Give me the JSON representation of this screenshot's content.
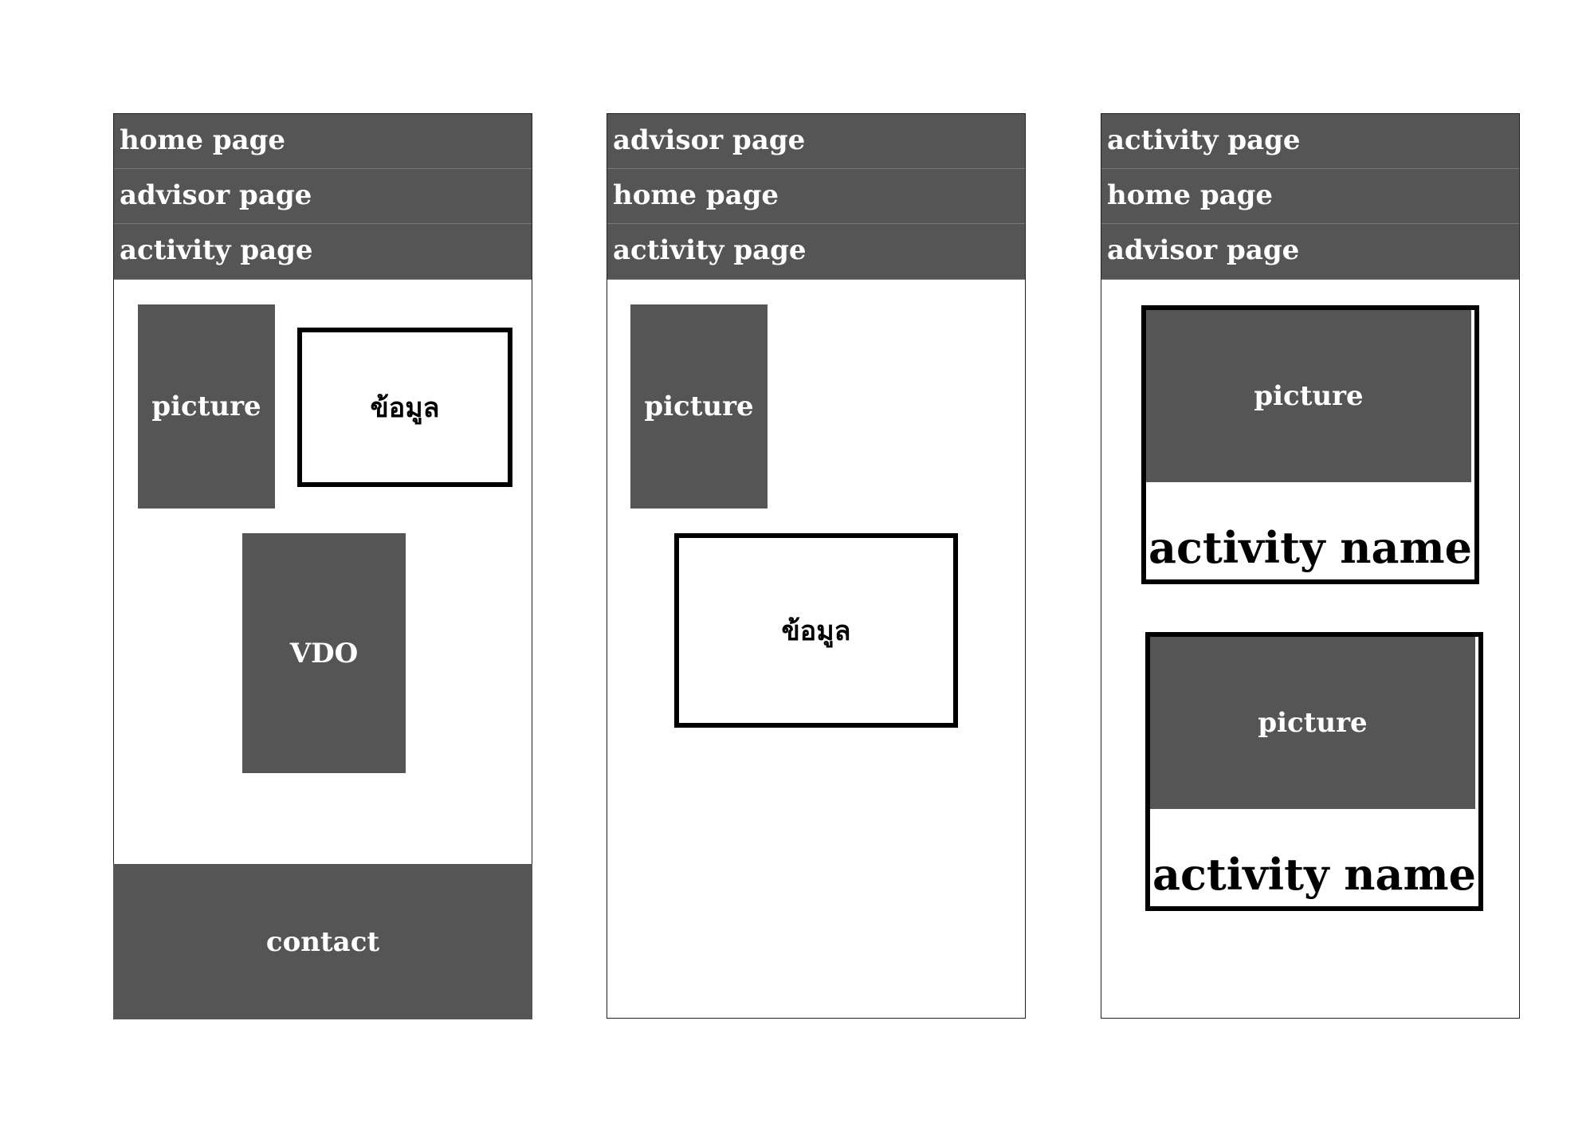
{
  "colors": {
    "block": "#555555",
    "text_light": "#ffffff",
    "border": "#000000"
  },
  "panels": [
    {
      "nav": [
        "home page",
        "advisor page",
        "activity page"
      ],
      "picture": "picture",
      "info": "ข้อมูล",
      "video": "VDO",
      "contact": "contact"
    },
    {
      "nav": [
        "advisor page",
        "home page",
        "activity page"
      ],
      "picture": "picture",
      "info": "ข้อมูล"
    },
    {
      "nav": [
        "activity page",
        "home page",
        "advisor page"
      ],
      "cards": [
        {
          "picture": "picture",
          "name": "activity name"
        },
        {
          "picture": "picture",
          "name": "activity name"
        }
      ]
    }
  ]
}
